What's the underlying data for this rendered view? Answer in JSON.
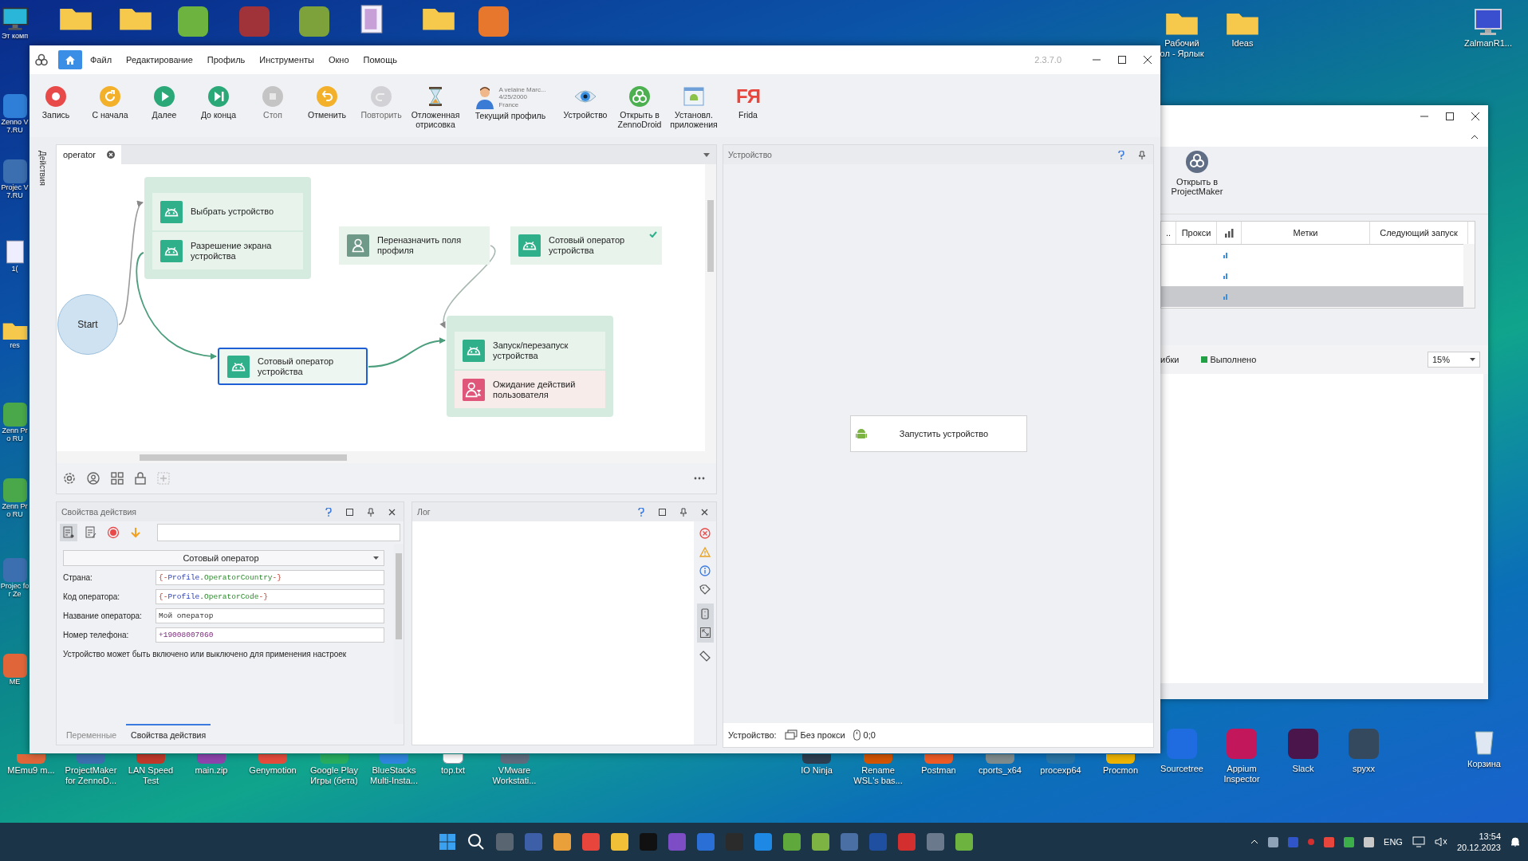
{
  "desktop": {
    "left_icons": [
      {
        "kind": "monitor",
        "label": "Эт комп"
      },
      {
        "kind": "app",
        "color": "#2f7fd8",
        "label": "Zenno V7.RU"
      },
      {
        "kind": "app",
        "color": "#3c6fb0",
        "label": "Projec V7.RU"
      },
      {
        "kind": "file",
        "label": "1("
      },
      {
        "kind": "folder",
        "label": "res"
      },
      {
        "kind": "app",
        "color": "#4aa84a",
        "label": "Zenn Pro RU"
      },
      {
        "kind": "app",
        "color": "#4aa84a",
        "label": "Zenn Pro RU"
      },
      {
        "kind": "app",
        "color": "#3c6fb0",
        "label": "Projec for Ze"
      },
      {
        "kind": "app",
        "color": "#e0663a",
        "label": "ME"
      }
    ],
    "top_icons": [
      {
        "kind": "folder"
      },
      {
        "kind": "folder"
      },
      {
        "kind": "app",
        "color": "#6cb33f"
      },
      {
        "kind": "app",
        "color": "#a0323a"
      },
      {
        "kind": "app",
        "color": "#7da23c"
      },
      {
        "kind": "file"
      },
      {
        "kind": "folder"
      },
      {
        "kind": "app",
        "color": "#e8772e"
      }
    ],
    "right_icons": [
      {
        "kind": "folder",
        "label": "Рабочий\nол - Ярлык"
      },
      {
        "kind": "folder",
        "label": "Ideas"
      },
      {
        "kind": "monitor",
        "label": "ZalmanR1..."
      }
    ],
    "bottom_icons": [
      {
        "kind": "app",
        "color": "#e0663a",
        "label": "MEmu9 m..."
      },
      {
        "kind": "app",
        "color": "#3c6fb0",
        "label": "ProjectMaker for ZennoD..."
      },
      {
        "kind": "app",
        "color": "#c0392b",
        "label": "LAN Speed Test"
      },
      {
        "kind": "app",
        "color": "#8e44ad",
        "label": "main.zip"
      },
      {
        "kind": "app",
        "color": "#e74c3c",
        "label": "Genymotion"
      },
      {
        "kind": "app",
        "color": "#27ae60",
        "label": "Google Play Игры (бета)"
      },
      {
        "kind": "app",
        "color": "#2e86de",
        "label": "BlueStacks Multi-Insta..."
      },
      {
        "kind": "file",
        "label": "top.txt"
      },
      {
        "kind": "app",
        "color": "#5d6d7e",
        "label": "VMware Workstati..."
      },
      {
        "kind": "app",
        "color": "#2c3e50",
        "label": "IO Ninja"
      },
      {
        "kind": "app",
        "color": "#d35400",
        "label": "Rename WSL's bas..."
      },
      {
        "kind": "app",
        "color": "#ef5b25",
        "label": "Postman"
      },
      {
        "kind": "app",
        "color": "#7f8c8d",
        "label": "cports_x64"
      },
      {
        "kind": "app",
        "color": "#2874a6",
        "label": "procexp64"
      },
      {
        "kind": "app",
        "color": "#f0b400",
        "label": "Procmon"
      },
      {
        "kind": "app",
        "color": "#1e6ce0",
        "label": "Sourcetree"
      },
      {
        "kind": "app",
        "color": "#c2185b",
        "label": "Appium Inspector"
      },
      {
        "kind": "app",
        "color": "#4a154b",
        "label": "Slack"
      },
      {
        "kind": "app",
        "color": "#34495e",
        "label": "spyxx"
      },
      {
        "kind": "trash",
        "label": "Корзина"
      }
    ]
  },
  "window": {
    "menu": [
      "Файл",
      "Редактирование",
      "Профиль",
      "Инструменты",
      "Окно",
      "Помощь"
    ],
    "version": "2.3.7.0",
    "toolbar": [
      {
        "kind": "record",
        "label": "Запись",
        "disabled": false
      },
      {
        "kind": "restart",
        "label": "С начала",
        "disabled": false
      },
      {
        "kind": "play",
        "label": "Далее",
        "disabled": false
      },
      {
        "kind": "skip",
        "label": "До конца",
        "disabled": false
      },
      {
        "kind": "stop",
        "label": "Стоп",
        "disabled": true
      },
      {
        "kind": "undo",
        "label": "Отменить",
        "disabled": false
      },
      {
        "kind": "redo",
        "label": "Повторить",
        "disabled": true
      },
      {
        "kind": "hourglass",
        "label": "Отложенная отрисовка",
        "disabled": false
      },
      {
        "kind": "profile",
        "label": "Текущий профиль",
        "name": "A velaine Marc...",
        "date": "4/25/2000",
        "country": "France",
        "disabled": false
      },
      {
        "kind": "eye",
        "label": "Устройство",
        "disabled": false
      },
      {
        "kind": "droid",
        "label": "Открыть в ZennoDroid",
        "disabled": false
      },
      {
        "kind": "apps",
        "label": "Установл. приложения",
        "disabled": false
      },
      {
        "kind": "frida",
        "label": "Frida",
        "icon_text": "FЯ",
        "disabled": false
      }
    ],
    "side_tab": "Действия",
    "editor": {
      "tabs": [
        {
          "label": "operator",
          "selected": true
        }
      ],
      "blocks": [
        {
          "kind": "group",
          "actions": [
            {
              "kind": "android",
              "label": "Выбрать устройство",
              "selected": false,
              "checked": false
            },
            {
              "kind": "android",
              "label": "Разрешение экрана устройства",
              "selected": false,
              "checked": false
            }
          ]
        },
        {
          "kind": "action",
          "action": {
            "kind": "profile",
            "label": "Переназначить поля профиля",
            "selected": false,
            "checked": false
          }
        },
        {
          "kind": "action",
          "action": {
            "kind": "android",
            "label": "Сотовый оператор устройства",
            "selected": false,
            "checked": true
          }
        },
        {
          "kind": "start",
          "label": "Start"
        },
        {
          "kind": "action",
          "action": {
            "kind": "android",
            "label": "Сотовый оператор устройства",
            "selected": true,
            "checked": false
          }
        },
        {
          "kind": "group",
          "actions": [
            {
              "kind": "android",
              "label": "Запуск/перезапуск устройства",
              "selected": false,
              "checked": false
            },
            {
              "kind": "wait",
              "label": "Ожидание действий пользователя",
              "selected": false,
              "checked": false
            }
          ]
        }
      ]
    },
    "properties": {
      "title": "Свойства действия",
      "action_type": "Сотовый оператор",
      "fields": [
        {
          "label": "Страна:",
          "value": [
            {
              "kind": "brace",
              "text": "{-"
            },
            {
              "kind": "object",
              "text": "Profile"
            },
            {
              "kind": "text",
              "text": "."
            },
            {
              "kind": "property",
              "text": "OperatorCountry"
            },
            {
              "kind": "brace",
              "text": "-}"
            }
          ]
        },
        {
          "label": "Код оператора:",
          "value": [
            {
              "kind": "brace",
              "text": "{-"
            },
            {
              "kind": "object",
              "text": "Profile"
            },
            {
              "kind": "text",
              "text": "."
            },
            {
              "kind": "property",
              "text": "OperatorCode"
            },
            {
              "kind": "brace",
              "text": "-}"
            }
          ]
        },
        {
          "label": "Название оператора:",
          "value": [
            {
              "kind": "text",
              "text": "Мой оператор"
            }
          ]
        },
        {
          "label": "Номер телефона:",
          "value": [
            {
              "kind": "number",
              "text": "+19008007060"
            }
          ]
        }
      ],
      "note": "Устройство может быть включено или выключено для применения настроек",
      "tabs": [
        {
          "label": "Переменные",
          "selected": false
        },
        {
          "label": "Свойства действия",
          "selected": true
        }
      ]
    },
    "log": {
      "title": "Лог"
    },
    "device": {
      "title": "Устройство",
      "start_button": "Запустить устройство",
      "status_label": "Устройство:",
      "proxy": "Без прокси",
      "coords": "0;0"
    }
  },
  "second_window": {
    "open_button": "Открыть в ProjectMaker",
    "columns": [
      "..",
      "Прокси",
      "",
      "Метки",
      "Следующий запуск"
    ],
    "rows": [
      {
        "selected": false
      },
      {
        "selected": false
      },
      {
        "selected": true
      }
    ],
    "legend": [
      {
        "label": "ибки"
      },
      {
        "label": "Выполнено",
        "color": "#22a045"
      }
    ],
    "zoom": "15%"
  },
  "taskbar": {
    "apps": [
      {
        "kind": "start"
      },
      {
        "kind": "search"
      },
      {
        "kind": "app",
        "color": "#5a6572"
      },
      {
        "kind": "app",
        "color": "#3c5fa8"
      },
      {
        "kind": "app",
        "color": "#e9a03b"
      },
      {
        "kind": "app",
        "color": "#e8453c"
      },
      {
        "kind": "app",
        "color": "#f2c037"
      },
      {
        "kind": "app",
        "color": "#111111"
      },
      {
        "kind": "app",
        "color": "#7c4dc4"
      },
      {
        "kind": "app",
        "color": "#2a6fd6"
      },
      {
        "kind": "app",
        "color": "#2b2b2b"
      },
      {
        "kind": "app",
        "color": "#1e88e5"
      },
      {
        "kind": "app",
        "color": "#5fa83b"
      },
      {
        "kind": "app",
        "color": "#7cb342"
      },
      {
        "kind": "app",
        "color": "#4a6fa5"
      },
      {
        "kind": "app",
        "color": "#1e4fa0"
      },
      {
        "kind": "app",
        "color": "#d32f2f"
      },
      {
        "kind": "app",
        "color": "#6a7a8c"
      },
      {
        "kind": "app",
        "color": "#6cb33f"
      }
    ],
    "language": "ENG",
    "time": "13:54",
    "date": "20.12.2023"
  }
}
